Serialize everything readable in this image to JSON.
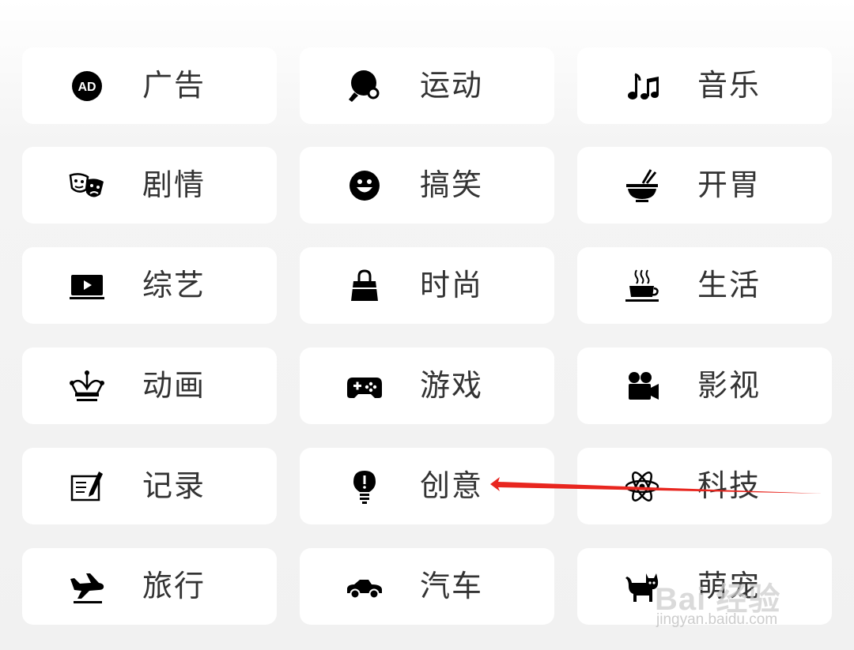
{
  "categories": [
    {
      "label": "广告",
      "icon": "ad-icon"
    },
    {
      "label": "运动",
      "icon": "ping-pong-icon"
    },
    {
      "label": "音乐",
      "icon": "music-notes-icon"
    },
    {
      "label": "剧情",
      "icon": "theater-masks-icon"
    },
    {
      "label": "搞笑",
      "icon": "smile-icon"
    },
    {
      "label": "开胃",
      "icon": "noodle-bowl-icon"
    },
    {
      "label": "综艺",
      "icon": "tv-play-icon"
    },
    {
      "label": "时尚",
      "icon": "handbag-icon"
    },
    {
      "label": "生活",
      "icon": "coffee-cup-icon"
    },
    {
      "label": "动画",
      "icon": "jester-hat-icon"
    },
    {
      "label": "游戏",
      "icon": "gamepad-icon"
    },
    {
      "label": "影视",
      "icon": "movie-camera-icon"
    },
    {
      "label": "记录",
      "icon": "pen-note-icon"
    },
    {
      "label": "创意",
      "icon": "lightbulb-icon"
    },
    {
      "label": "科技",
      "icon": "atom-icon"
    },
    {
      "label": "旅行",
      "icon": "airplane-landing-icon"
    },
    {
      "label": "汽车",
      "icon": "car-icon"
    },
    {
      "label": "萌宠",
      "icon": "cat-icon"
    }
  ],
  "icon_glyphs": {
    "ad": "AD"
  },
  "annotation": {
    "color": "#e8261f",
    "points_to": "创意"
  },
  "watermark": {
    "logo": "Bai 经验",
    "url": "jingyan.baidu.com"
  }
}
